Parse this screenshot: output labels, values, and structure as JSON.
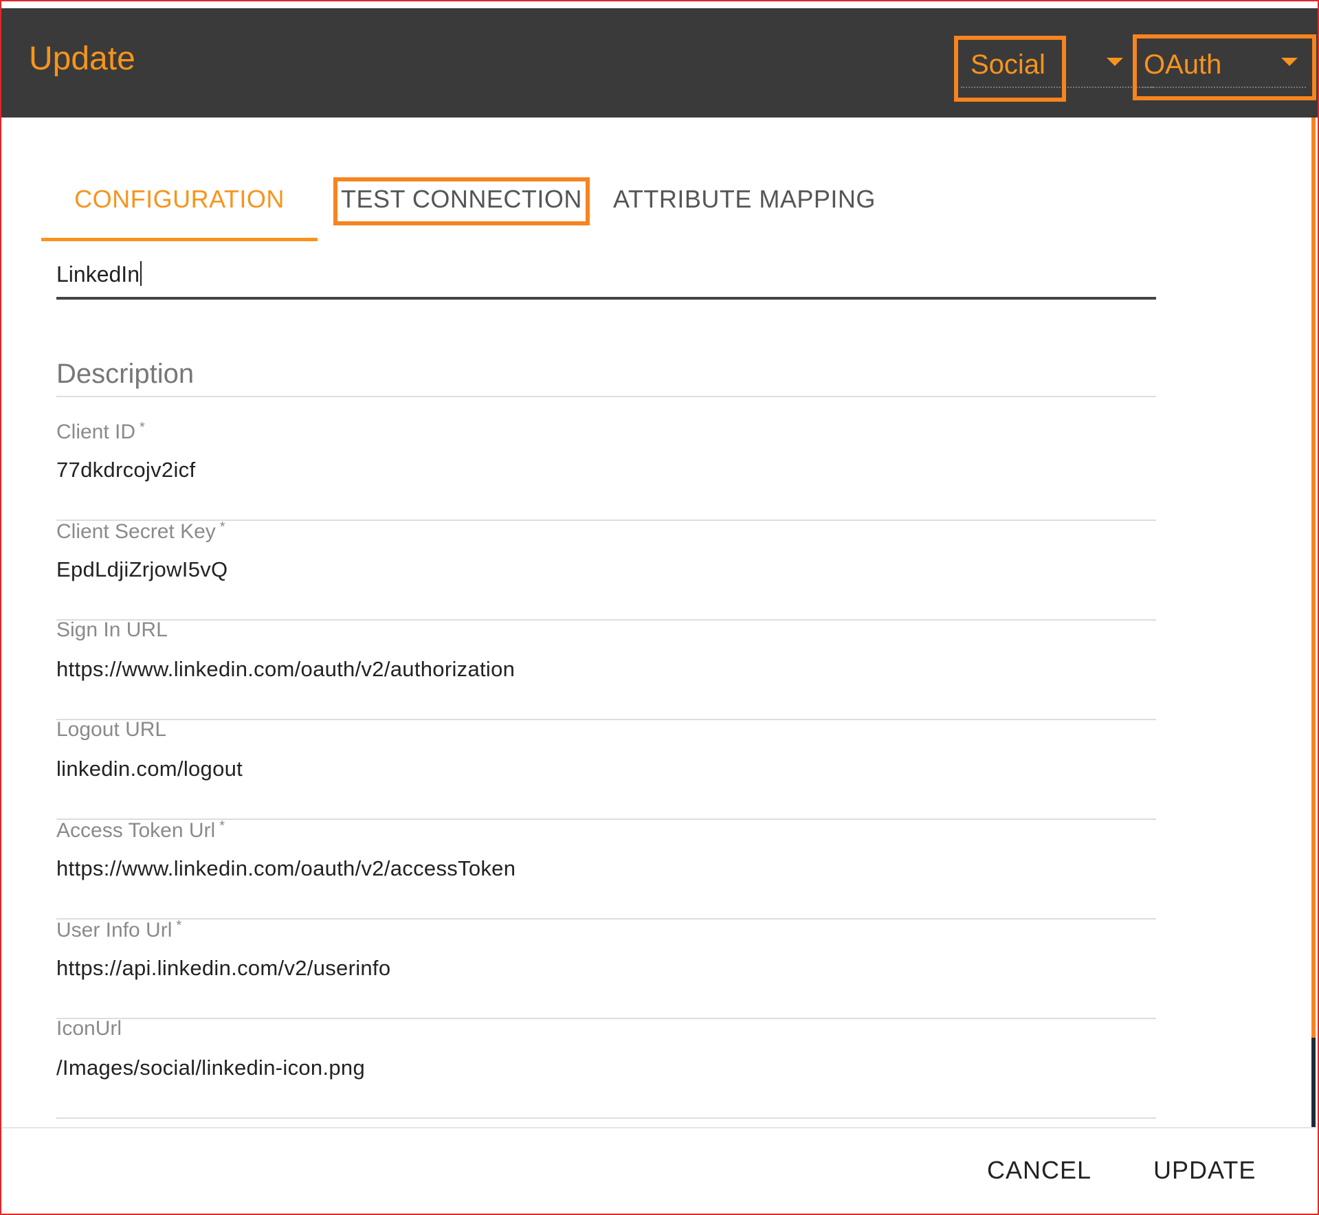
{
  "dialog": {
    "title": "Update"
  },
  "header": {
    "category_select": {
      "value": "Social"
    },
    "type_select": {
      "value": "OAuth"
    }
  },
  "tabs": [
    {
      "label": "CONFIGURATION",
      "active": true
    },
    {
      "label": "TEST CONNECTION",
      "active": false,
      "highlighted": true
    },
    {
      "label": "ATTRIBUTE MAPPING",
      "active": false
    }
  ],
  "form": {
    "name": {
      "value": "LinkedIn"
    },
    "description": {
      "placeholder": "Description"
    },
    "client_id": {
      "label": "Client ID",
      "required": "*",
      "value": "77dkdrcojv2icf"
    },
    "client_secret": {
      "label": "Client Secret Key",
      "required": "*",
      "value": "EpdLdjiZrjowI5vQ"
    },
    "sign_in_url": {
      "label": "Sign In URL",
      "value": "https://www.linkedin.com/oauth/v2/authorization"
    },
    "logout_url": {
      "label": "Logout URL",
      "value": "linkedin.com/logout"
    },
    "access_token_url": {
      "label": "Access Token Url",
      "required": "*",
      "value": "https://www.linkedin.com/oauth/v2/accessToken"
    },
    "user_info_url": {
      "label": "User Info Url",
      "required": "*",
      "value": "https://api.linkedin.com/v2/userinfo"
    },
    "icon_url": {
      "label": "IconUrl",
      "value": "/Images/social/linkedin-icon.png"
    }
  },
  "footer": {
    "cancel_label": "CANCEL",
    "update_label": "UPDATE"
  },
  "colors": {
    "accent": "#f7941d",
    "header_bg": "#3a3a3a",
    "highlight": "#f7841f",
    "frame_border": "#e3262a"
  },
  "icons": {
    "select_arrow": "caret-down-icon"
  }
}
